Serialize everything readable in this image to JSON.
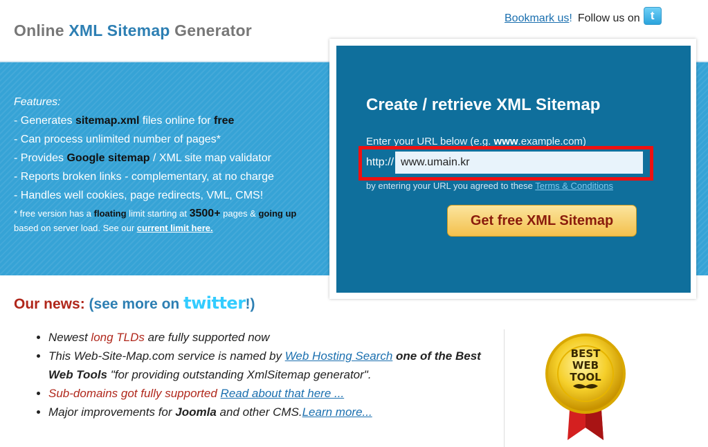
{
  "header": {
    "title_part1": "Online",
    "title_part2": "XML Sitemap",
    "title_part3": "Generator",
    "bookmark_link": "Bookmark us",
    "bookmark_suffix": "!",
    "follow_text": "Follow us on",
    "twitter_icon": "twitter-icon"
  },
  "features": {
    "heading": "Features:",
    "items": [
      {
        "pre": "- Generates ",
        "b1": "sitemap.xml",
        "mid": " files online for ",
        "b2": "free"
      },
      {
        "pre": "- Can process unlimited number of pages*"
      },
      {
        "pre": "- Provides ",
        "b1": "Google sitemap",
        "mid": " / XML site map validator"
      },
      {
        "pre": "- Reports broken links - complementary, at no charge"
      },
      {
        "pre": "- Handles well cookies, page redirects, VML, CMS!"
      }
    ],
    "note_a": "* free version has a ",
    "note_floating": "floating",
    "note_b": " limit starting at ",
    "note_limit": "3500+",
    "note_c": " pages & ",
    "note_going_up": "going up",
    "note_d": " based on server load. See our ",
    "note_link": "current limit here."
  },
  "panel": {
    "heading": "Create / retrieve XML Sitemap",
    "enter_a": "Enter your URL below (e.g. ",
    "enter_b": "www",
    "enter_c": ".example.com)",
    "url_prefix": "http://",
    "url_value": "www.umain.kr",
    "terms_text": "by entering your URL you agreed to these ",
    "terms_link": "Terms & Conditions",
    "button": "Get free XML Sitemap"
  },
  "news": {
    "title": "Our news:",
    "see_more": "(see more on",
    "twitter_word": "twitter",
    "close": "!)",
    "items": [
      {
        "a": "Newest ",
        "red": "long TLDs",
        "b": " are fully supported now"
      },
      {
        "a": "This Web-Site-Map.com service is named by ",
        "link": "Web Hosting Search",
        "bold": " one of the Best Web Tools",
        "b": " \"for providing outstanding XmlSitemap generator\"."
      },
      {
        "red": "Sub-domains got fully supported",
        "link": "Read about that here ..."
      },
      {
        "a": "Major improvements for ",
        "bold": "Joomla",
        "b": " and other CMS.",
        "link": "Learn more..."
      }
    ]
  },
  "badge": {
    "line1": "BEST",
    "line2": "WEB",
    "line3": "TOOL",
    "icon": "award-badge-icon"
  },
  "colors": {
    "band": "#36a3d6",
    "panel": "#0f6f9c",
    "highlight": "#ee1111",
    "button": "#f3c04d",
    "news_red": "#b0271b"
  }
}
